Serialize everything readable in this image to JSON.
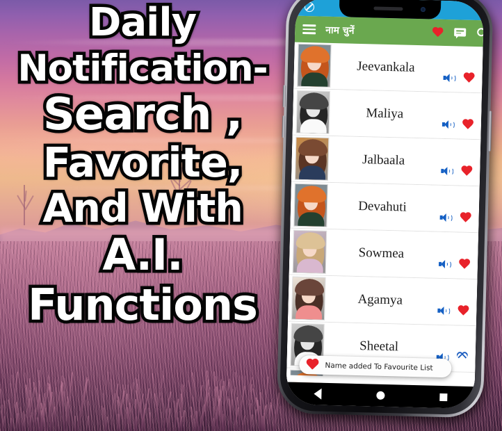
{
  "promo": {
    "lines": [
      "Daily",
      "Notification-",
      "Search ,",
      "Favorite,",
      "And With",
      "A.I.",
      "Functions"
    ]
  },
  "phone": {
    "status_bar": {
      "color": "#1ea1d8",
      "icons": [
        "silent-mode-icon"
      ]
    },
    "app_bar": {
      "color": "#6aa84f",
      "menu_icon": "hamburger-menu-icon",
      "title": "नाम चुनें",
      "actions": [
        "favorites-heart-icon",
        "chat-icon",
        "search-icon"
      ]
    },
    "list": {
      "rows": [
        {
          "name": "Jeevankala",
          "favorited": true,
          "speaker": "volume-icon",
          "avatar_style": "redhead-green"
        },
        {
          "name": "Maliya",
          "favorited": true,
          "speaker": "volume-icon",
          "avatar_style": "grayscale-braid"
        },
        {
          "name": "Jalbaala",
          "favorited": true,
          "speaker": "volume-icon",
          "avatar_style": "brunette-warm"
        },
        {
          "name": "Devahuti",
          "favorited": true,
          "speaker": "volume-icon",
          "avatar_style": "redhead-green"
        },
        {
          "name": "Sowmea",
          "favorited": true,
          "speaker": "volume-icon",
          "avatar_style": "blonde-pink"
        },
        {
          "name": "Agamya",
          "favorited": true,
          "speaker": "volume-icon",
          "avatar_style": "darkhair-pink"
        },
        {
          "name": "Sheetal",
          "favorited": false,
          "speaker": "volume-icon",
          "avatar_style": "grayscale-braid"
        },
        {
          "name": "",
          "favorited": false,
          "speaker": "volume-icon",
          "avatar_style": "redhead-green"
        }
      ]
    },
    "toast": {
      "icon": "heart-icon",
      "message": "Name added To Favourite List"
    },
    "nav_bar": {
      "items": [
        "back-button",
        "home-button",
        "recents-button"
      ]
    }
  },
  "colors": {
    "app_bar_green": "#6aa84f",
    "status_bar_blue": "#1ea1d8",
    "heart_red": "#e8222a",
    "speaker_blue": "#1560c4",
    "heart_outline_blue": "#1f5fc0"
  }
}
